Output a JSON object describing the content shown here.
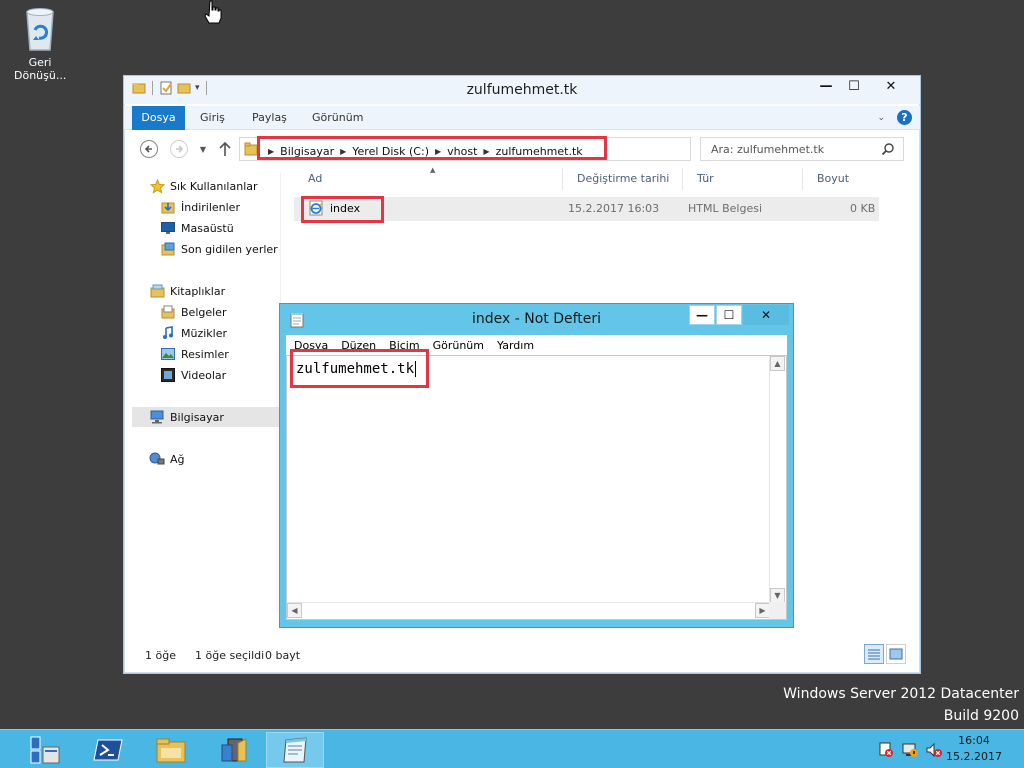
{
  "desktop": {
    "recycle_bin_label": "Geri Dönüşü...",
    "watermark": {
      "line1": "Windows Server 2012 Datacenter",
      "line2": "Build 9200"
    }
  },
  "explorer": {
    "title": "zulfumehmet.tk",
    "window_controls": {
      "minimize": "—",
      "maximize": "☐",
      "close": "✕"
    },
    "ribbon_tabs": [
      "Dosya",
      "Giriş",
      "Paylaş",
      "Görünüm"
    ],
    "breadcrumbs": [
      "Bilgisayar",
      "Yerel Disk (C:)",
      "vhost",
      "zulfumehmet.tk"
    ],
    "search_placeholder": "Ara: zulfumehmet.tk",
    "sidebar": {
      "favorites_header": "Sık Kullanılanlar",
      "favorites": [
        "İndirilenler",
        "Masaüstü",
        "Son gidilen yerler"
      ],
      "libraries_header": "Kitaplıklar",
      "libraries": [
        "Belgeler",
        "Müzikler",
        "Resimler",
        "Videolar"
      ],
      "computer": "Bilgisayar",
      "network": "Ağ"
    },
    "columns": [
      "Ad",
      "Değiştirme tarihi",
      "Tür",
      "Boyut"
    ],
    "files": [
      {
        "name": "index",
        "modified": "15.2.2017 16:03",
        "type": "HTML Belgesi",
        "size": "0 KB"
      }
    ],
    "status": {
      "count": "1 öğe",
      "selected": "1 öğe seçildi",
      "size": "0 bayt"
    }
  },
  "notepad": {
    "title": "index - Not Defteri",
    "menu": [
      "Dosya",
      "Düzen",
      "Biçim",
      "Görünüm",
      "Yardım"
    ],
    "content": "zulfumehmet.tk"
  },
  "taskbar": {
    "items": [
      "server-manager-icon",
      "powershell-icon",
      "file-explorer-icon",
      "iis-manager-icon",
      "notepad-icon"
    ],
    "clock_time": "16:04",
    "clock_date": "15.2.2017"
  },
  "colors": {
    "highlight_box": "#e53542",
    "ribbon_file_tab": "#1979ca",
    "notepad_frame": "#63c5e8",
    "taskbar": "#4ab6e4",
    "desktop": "#3d3d3d"
  }
}
